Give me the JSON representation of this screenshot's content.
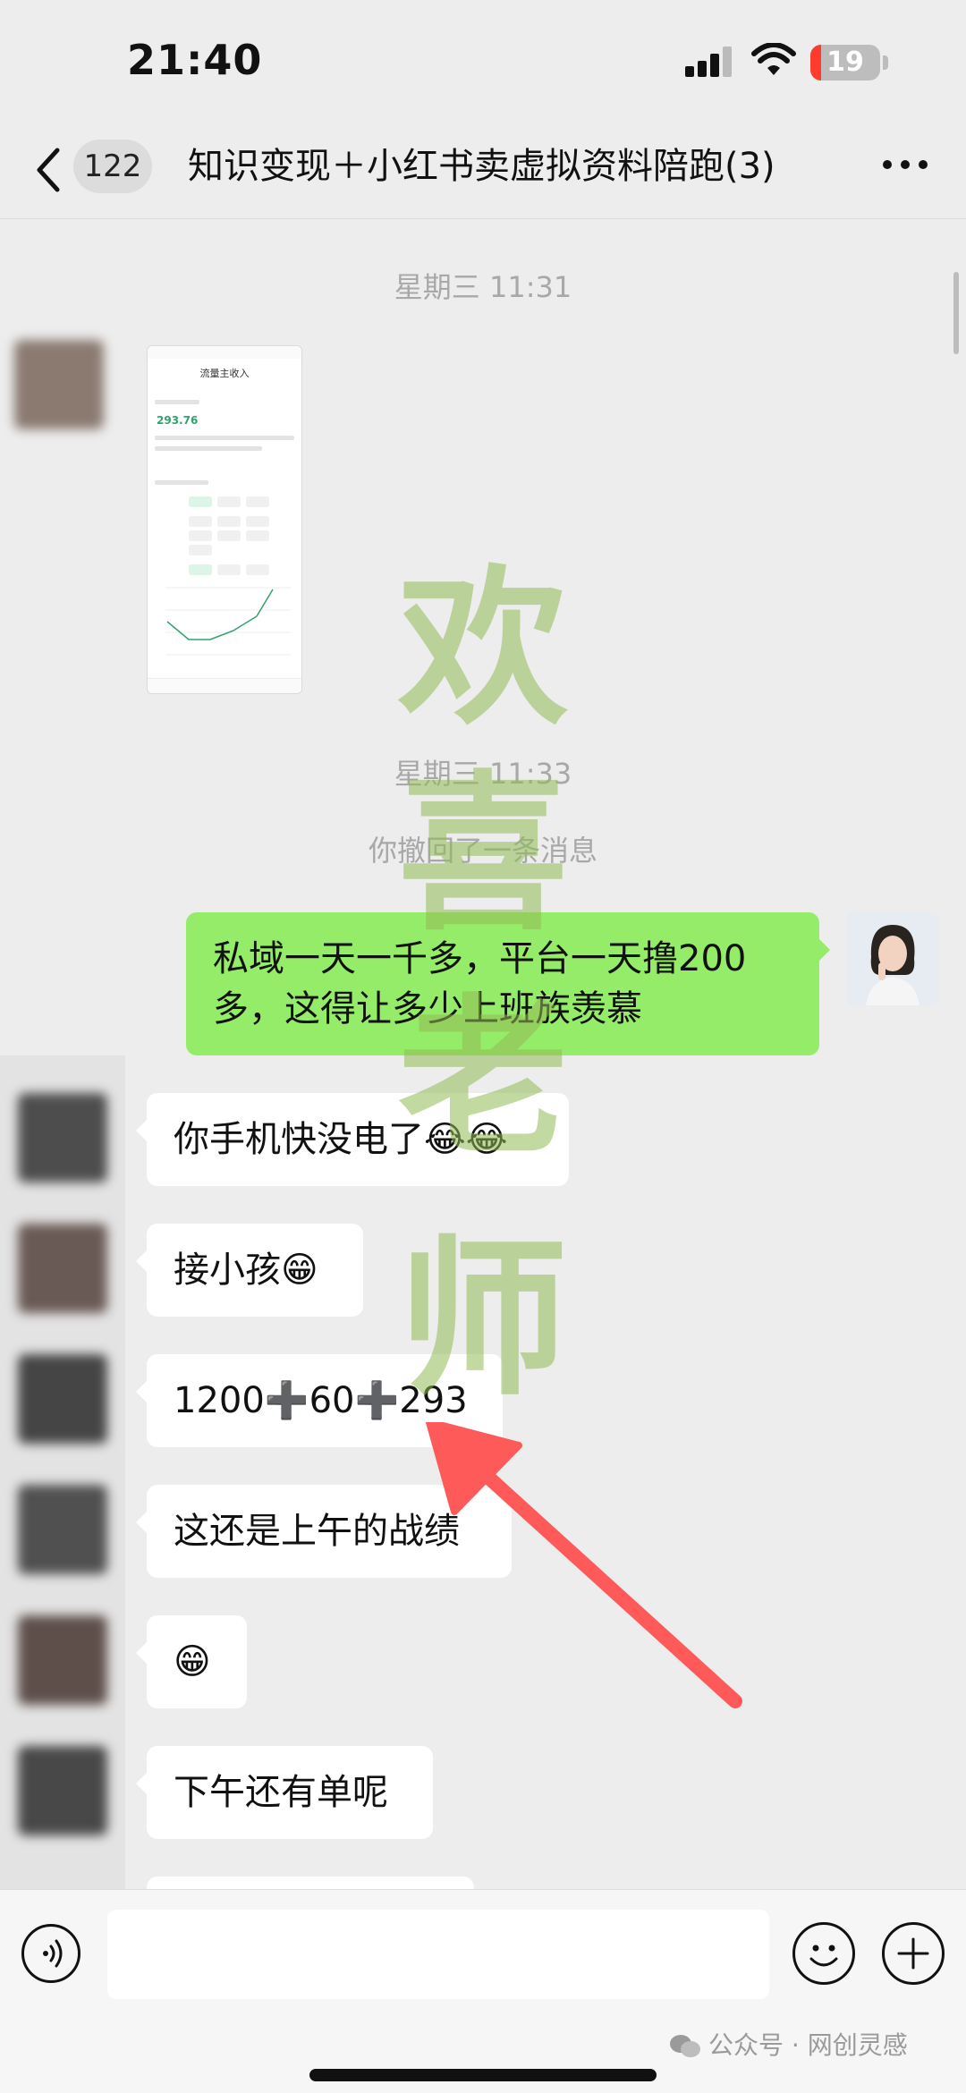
{
  "status_bar": {
    "time": "21:40",
    "battery": "19"
  },
  "header": {
    "back_count": "122",
    "title": "知识变现＋小红书卖虚拟资料陪跑(3)"
  },
  "messages": {
    "timestamp_1": "星期三 11:31",
    "shared_image": {
      "title": "流量主收入",
      "value": "293.76"
    },
    "timestamp_2": "星期三 11:33",
    "system_notice": "你撤回了一条消息",
    "my_message": "私域一天一千多，平台一天撸200多，这得让多少上班族羡慕",
    "replies": [
      {
        "text": "你手机快没电了",
        "emoji": "😂😂"
      },
      {
        "text": "接小孩",
        "emoji": "😁"
      },
      {
        "text": "1200➕60➕293",
        "emoji": ""
      },
      {
        "text": "这还是上午的战绩",
        "emoji": ""
      },
      {
        "text": "",
        "emoji": "😁"
      },
      {
        "text": "下午还有单呢",
        "emoji": ""
      }
    ]
  },
  "watermark": [
    "欢",
    "喜",
    "老",
    "师"
  ],
  "footer": {
    "label": "公众号 · 网创灵感"
  },
  "colors": {
    "my_bubble": "#95ec69",
    "background": "#ededed",
    "arrow": "#ff5a5a"
  }
}
